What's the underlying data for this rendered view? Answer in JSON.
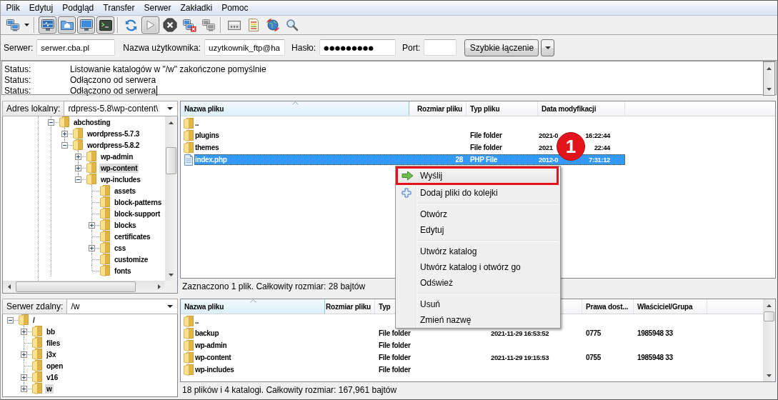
{
  "menu_bar": [
    "Plik",
    "Edytuj",
    "Podgląd",
    "Transfer",
    "Serwer",
    "Zakładki",
    "Pomoc"
  ],
  "toolbar": [
    {
      "kind": "sitemanager",
      "pressed": false
    },
    {
      "kind": "dropdown",
      "pressed": false
    },
    {
      "kind": "separator"
    },
    {
      "kind": "log",
      "pressed": true
    },
    {
      "kind": "localtree",
      "pressed": true
    },
    {
      "kind": "remotetree",
      "pressed": true
    },
    {
      "kind": "queue",
      "pressed": true
    },
    {
      "kind": "separator"
    },
    {
      "kind": "refresh",
      "pressed": false
    },
    {
      "kind": "process",
      "pressed": true
    },
    {
      "kind": "cancel",
      "pressed": false
    },
    {
      "kind": "disconnect",
      "pressed": false
    },
    {
      "kind": "reconnect",
      "pressed": false
    },
    {
      "kind": "separator"
    },
    {
      "kind": "filter",
      "pressed": false
    },
    {
      "kind": "compare",
      "pressed": false
    },
    {
      "kind": "sync",
      "pressed": false
    },
    {
      "kind": "search",
      "pressed": false
    }
  ],
  "quick_connect": {
    "fields": [
      {
        "kind": "text",
        "label": "Serwer:",
        "value": "serwer.cba.pl"
      },
      {
        "kind": "text",
        "label": "Nazwa użytkownika:",
        "value": "uzytkownik_ftp@ha"
      },
      {
        "kind": "password",
        "label": "Hasło:",
        "value": "●●●●●●●●●"
      },
      {
        "kind": "text",
        "label": "Port:"
      }
    ],
    "connect_button": "Szybkie łączenie"
  },
  "message_log": [
    {
      "label": "Status:",
      "text": "Listowanie katalogów w \"/w\" zakończone pomyślnie",
      "caret": false
    },
    {
      "label": "Status:",
      "text": "Odłączono od serwera",
      "caret": false
    },
    {
      "label": "Status:",
      "text": "Odłączono od serwera",
      "caret": true
    }
  ],
  "local": {
    "address_label": "Adres lokalny:",
    "address": "rdpress-5.8\\wp-content\\",
    "tree": [
      {
        "label": "abchosting",
        "expanded": true,
        "selected": false,
        "children": [
          {
            "label": "wordpress-5.7.3",
            "expanded": false,
            "selected": false
          },
          {
            "label": "wordpress-5.8.2",
            "expanded": true,
            "selected": false,
            "children": [
              {
                "label": "wp-admin",
                "expanded": false,
                "selected": false
              },
              {
                "label": "wp-content",
                "expanded": false,
                "selected": true
              },
              {
                "label": "wp-includes",
                "expanded": true,
                "selected": false,
                "children": [
                  {
                    "label": "assets",
                    "selected": false
                  },
                  {
                    "label": "block-patterns",
                    "selected": false
                  },
                  {
                    "label": "block-support",
                    "selected": false
                  },
                  {
                    "label": "blocks",
                    "expanded": false,
                    "selected": false
                  },
                  {
                    "label": "certificates",
                    "selected": false
                  },
                  {
                    "label": "css",
                    "expanded": false,
                    "selected": false
                  },
                  {
                    "label": "customize",
                    "selected": false
                  },
                  {
                    "label": "fonts",
                    "selected": false
                  }
                ]
              }
            ]
          }
        ]
      }
    ],
    "columns": [
      {
        "label": "Nazwa pliku",
        "sorted": true
      },
      {
        "label": "Rozmiar pliku",
        "sorted": false
      },
      {
        "label": "Typ pliku",
        "sorted": false
      },
      {
        "label": "Data modyfikacji",
        "sorted": false
      }
    ],
    "rows": [
      {
        "kind": "folder",
        "name": "..",
        "selected": false
      },
      {
        "kind": "folder",
        "name": "plugins",
        "type": "File folder",
        "modified": [
          "2021-0",
          "16:22:44"
        ],
        "selected": false
      },
      {
        "kind": "folder",
        "name": "themes",
        "type": "File folder",
        "modified": [
          "2021",
          "22:44"
        ],
        "selected": false
      },
      {
        "kind": "file",
        "name": "index.php",
        "size": "28",
        "type": "PHP File",
        "modified": [
          "2012-0",
          "7:31:12"
        ],
        "selected": true
      }
    ],
    "status": "Zaznaczono 1 plik. Całkowity rozmiar: 28 bajtów"
  },
  "remote": {
    "address_label": "Serwer zdalny:",
    "address": "/w",
    "tree": [
      {
        "label": "/",
        "expanded": true,
        "selected": false,
        "children": [
          {
            "label": "bb",
            "expanded": false,
            "selected": false
          },
          {
            "label": "files",
            "selected": false
          },
          {
            "label": "j3x",
            "expanded": false,
            "selected": false
          },
          {
            "label": "open",
            "selected": false
          },
          {
            "label": "v16",
            "expanded": false,
            "selected": false
          },
          {
            "label": "w",
            "expanded": false,
            "selected": true
          }
        ]
      }
    ],
    "columns": [
      {
        "label": "Nazwa pliku",
        "sorted": true
      },
      {
        "label": "Rozmiar pliku",
        "sorted": false
      },
      {
        "label": "Typ",
        "sorted": false
      },
      {
        "label": "Prawa dost...",
        "sorted": false
      },
      {
        "label": "Właściciel/Grupa",
        "sorted": false
      }
    ],
    "rows": [
      {
        "kind": "folder",
        "name": "..",
        "selected": false
      },
      {
        "kind": "folder",
        "name": "backup",
        "type": "File folder",
        "modified": "2021-11-29 16:53:52",
        "permissions": "0775",
        "owner": "1985948 33",
        "selected": false
      },
      {
        "kind": "folder",
        "name": "wp-admin",
        "type": "File folder",
        "selected": false
      },
      {
        "kind": "folder",
        "name": "wp-content",
        "type": "File folder",
        "modified": "2021-11-29 19:15:53",
        "permissions": "0755",
        "owner": "1985948 33",
        "selected": false
      },
      {
        "kind": "folder",
        "name": "wp-includes",
        "type": "File folder",
        "selected": false
      }
    ],
    "status": "18 plików i 4 katalogi. Całkowity rozmiar: 167,961 bajtów"
  },
  "context_menu": [
    {
      "kind": "upload",
      "label": "Wyślij",
      "highlighted": true
    },
    {
      "kind": "enqueue",
      "label": "Dodaj pliki do kolejki",
      "highlighted": false
    },
    {
      "kind": "separator"
    },
    {
      "kind": "plain",
      "label": "Otwórz",
      "highlighted": false
    },
    {
      "kind": "plain",
      "label": "Edytuj",
      "highlighted": false
    },
    {
      "kind": "separator"
    },
    {
      "kind": "plain",
      "label": "Utwórz katalog",
      "highlighted": false
    },
    {
      "kind": "plain",
      "label": "Utwórz katalog i otwórz go",
      "highlighted": false
    },
    {
      "kind": "plain",
      "label": "Odśwież",
      "highlighted": false
    },
    {
      "kind": "separator"
    },
    {
      "kind": "plain",
      "label": "Usuń",
      "highlighted": false
    },
    {
      "kind": "plain",
      "label": "Zmień nazwę",
      "highlighted": false
    }
  ],
  "step_badge": "1"
}
